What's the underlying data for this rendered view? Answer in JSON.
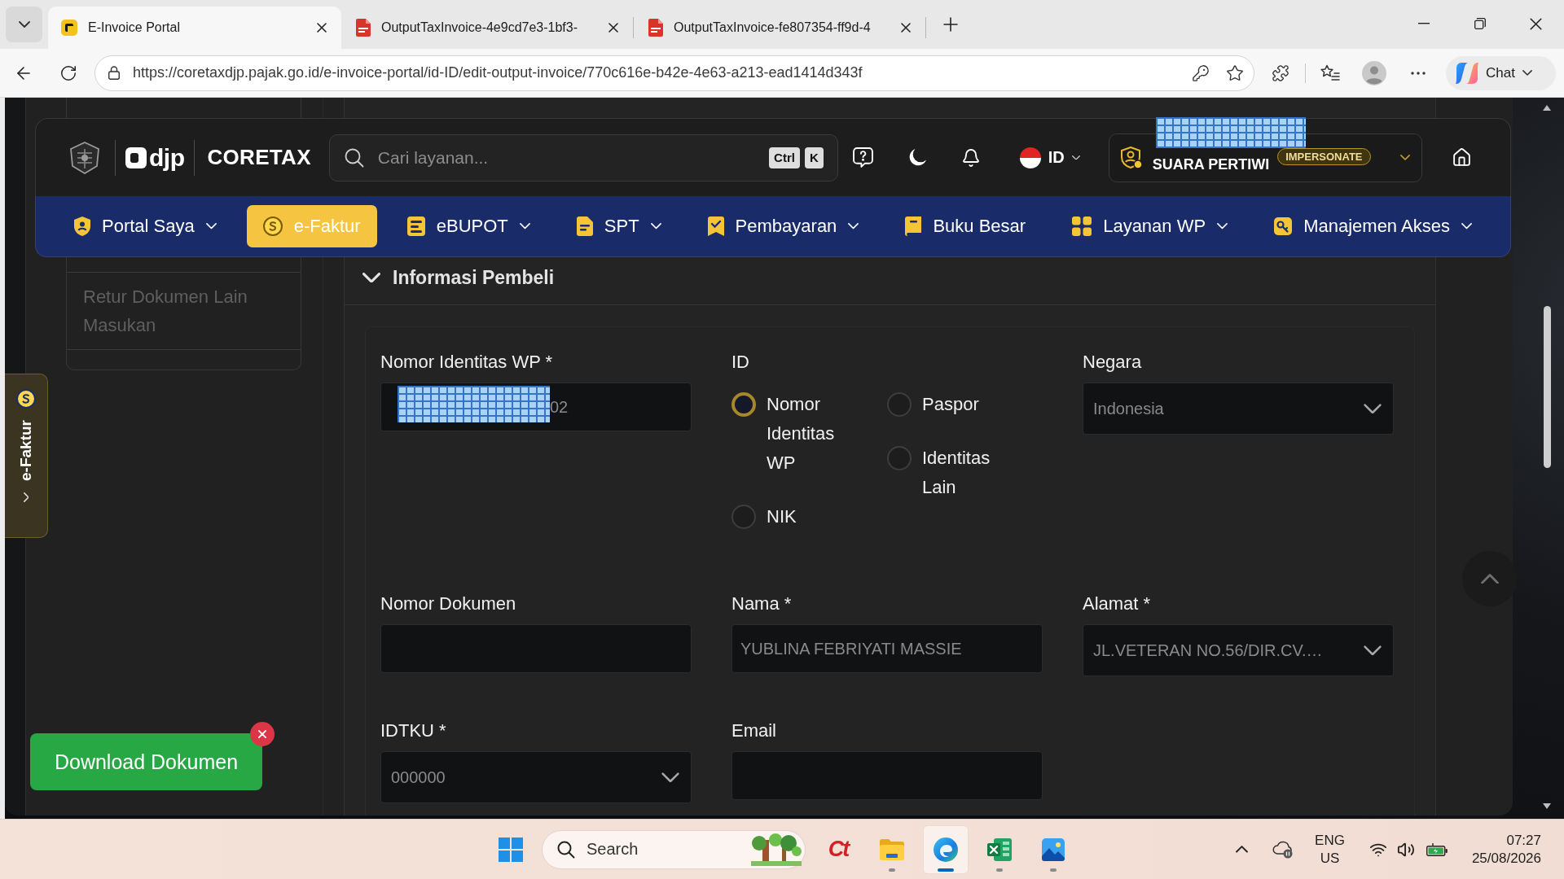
{
  "browser": {
    "tabs": [
      {
        "kind": "site",
        "title": "E-Invoice Portal",
        "selected": true
      },
      {
        "kind": "pdf",
        "title": "OutputTaxInvoice-4e9cd7e3-1bf3-",
        "selected": false
      },
      {
        "kind": "pdf",
        "title": "OutputTaxInvoice-fe807354-ff9d-4",
        "selected": false
      }
    ],
    "url": "https://coretaxdjp.pajak.go.id/e-invoice-portal/id-ID/edit-output-invoice/770c616e-b42e-4e63-a213-ead1414d343f",
    "chat": "Chat"
  },
  "header": {
    "brand": "djp",
    "product": "CORETAX",
    "search": {
      "placeholder": "Cari layanan..."
    },
    "shortcut": [
      "Ctrl",
      "K"
    ],
    "language": "ID",
    "user": {
      "name": "SUARA PERTIWI",
      "badge": "IMPERSONATE",
      "redacted": true
    }
  },
  "nav": [
    {
      "kind": "portal",
      "label": "Portal Saya",
      "menu": true,
      "selected": false
    },
    {
      "kind": "faktur",
      "label": "e-Faktur",
      "menu": false,
      "selected": true
    },
    {
      "kind": "bupot",
      "label": "eBUPOT",
      "menu": true,
      "selected": false
    },
    {
      "kind": "spt",
      "label": "SPT",
      "menu": true,
      "selected": false
    },
    {
      "kind": "payment",
      "label": "Pembayaran",
      "menu": true,
      "selected": false
    },
    {
      "kind": "ledger",
      "label": "Buku Besar",
      "menu": false,
      "selected": false
    },
    {
      "kind": "services",
      "label": "Layanan WP",
      "menu": true,
      "selected": false
    },
    {
      "kind": "access",
      "label": "Manajemen Akses",
      "menu": true,
      "selected": false
    }
  ],
  "side_tab": {
    "label": "e-Faktur"
  },
  "sidebar": {
    "items": [
      {
        "label": "Retur Dokumen Lain Masukan"
      }
    ]
  },
  "section": {
    "title": "Informasi Pembeli",
    "expanded": true,
    "fields": [
      {
        "kind": "text",
        "label": "Nomor Identitas WP *",
        "value": "02",
        "redacted": true
      },
      {
        "kind": "radio",
        "label": "ID",
        "options": [
          {
            "label": "Nomor Identitas WP",
            "selected": true
          },
          {
            "label": "NIK",
            "selected": false
          },
          {
            "label": "Paspor",
            "selected": false
          },
          {
            "label": "Identitas Lain",
            "selected": false
          }
        ]
      },
      {
        "kind": "select",
        "label": "Negara",
        "value": "Indonesia"
      },
      {
        "kind": "text",
        "label": "Nomor Dokumen"
      },
      {
        "kind": "text",
        "label": "Nama *",
        "value": "YUBLINA FEBRIYATI MASSIE"
      },
      {
        "kind": "select",
        "label": "Alamat *",
        "value": "JL.VETERAN NO.56/DIR.CV.…"
      },
      {
        "kind": "select",
        "label": "IDTKU *",
        "value": "000000"
      },
      {
        "kind": "text",
        "label": "Email"
      }
    ]
  },
  "download": {
    "label": "Download Dokumen"
  },
  "taskbar": {
    "search": {
      "placeholder": "Search"
    },
    "apps": [
      {
        "kind": "ct",
        "logo": "Ct",
        "running": false,
        "selected": false
      },
      {
        "kind": "folder",
        "running": true,
        "selected": false
      },
      {
        "kind": "edge",
        "running": true,
        "selected": true
      },
      {
        "kind": "excel",
        "running": true,
        "selected": false
      },
      {
        "kind": "photos",
        "running": true,
        "selected": false
      }
    ],
    "language": [
      "ENG",
      "US"
    ],
    "time": "07:27",
    "date": "25/08/2026"
  }
}
